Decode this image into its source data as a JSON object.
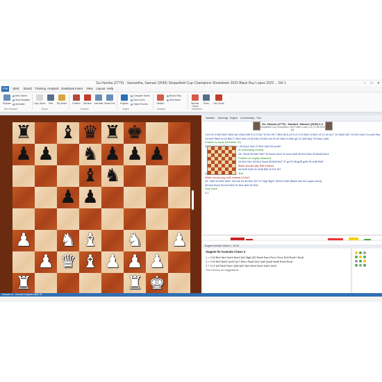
{
  "window": {
    "title": "Gu Harsha (2775) - Samantha, Samuel (2649) Sinquefield Cup Champions Showdown 2022  Black Ruy Lopez 2022 ... Rd 1"
  },
  "menu": [
    "File",
    "Start",
    "Board",
    "Training",
    "Analysis",
    "Database",
    "Insert",
    "View",
    "Layout",
    "Help"
  ],
  "ribbon": {
    "buttons": [
      {
        "label": "Replace",
        "color": "#6a8fb8"
      },
      {
        "label": "Copy Game",
        "color": "#d7d7d7"
      },
      {
        "label": "Print",
        "color": "#5b6f8a"
      },
      {
        "label": "Flip Board",
        "color": "#d9a441"
      },
      {
        "label": "Position",
        "color": "#b44a3a"
      },
      {
        "label": "Resume",
        "color": "#c23c2c"
      },
      {
        "label": "Annotate",
        "color": "#6a8fb8"
      },
      {
        "label": "Board Pos",
        "color": "#6a8fb8"
      },
      {
        "label": "Engines",
        "color": "#2f6fb4"
      },
      {
        "label": "Kibitzer",
        "color": "#d65a4a"
      },
      {
        "label": "Blunder Check",
        "color": "#d65a4a"
      },
      {
        "label": "Show",
        "color": "#5a6c88"
      },
      {
        "label": "Lets Check",
        "color": "#c23c2c"
      }
    ],
    "small_items": [
      "New Game",
      "Save Notation",
      "Annotate",
      "Compare Notes",
      "Save Lines",
      "Game Scores",
      "Board Help",
      "Add Notes"
    ],
    "groups": [
      "New Analysis",
      "Board",
      "Notation",
      "Engine",
      "Analysis",
      "Databases",
      "Tool",
      "Lets Check"
    ]
  },
  "notation": {
    "tabs": [
      "Notation",
      "Openings",
      "Engine",
      "Commentary",
      "Tree"
    ],
    "players": "Gu, Harsha (2775) - Samant, Samuel (2649) 0-0",
    "event": "Sinquefield Cup Champions 2022 Saint Louis (1.3)  21.08.2022",
    "result": "[A]",
    "lines": [
      {
        "text": "1.e4 e5 2.Nf3 Nc6 3.Bb5 a6 4.Ba4 Nf6 5.O-O Be7 6.Re1 b5 7.Bb3 d6 8.c3 O-O 9.h3 Na5 10.Bc2 c5 11.d4 Qc7 12.Nbd2 Bd7 13.Nf1 cxd4 14.cxd4 Rac8",
        "style": "n"
      },
      {
        "text": "15.Ne3 Rfe8 16.b3 Bf8 17.Bb2 Nc6 18.d5 Nb4 19.Bb1 a5 20.a3 Na6 21.Bd3 g6 22.Qd2 Bg7 23.Rac1 Qb8",
        "style": "n"
      },
      {
        "text": "Position is equal  (Stockfish 15)",
        "style": "c"
      },
      {
        "text": "24.Rxc8 Rxc8 25.Rc1 Rxc1+ 26.Qxc1 Nc5 27.Bc2 Qc8 28.Qxc8+",
        "style": "n"
      },
      {
        "text": "An interesting novelty.",
        "style": "c"
      },
      {
        "text": "28...Bxc8 29.Nd2 Nfd7 30.Ndc4 bxc4 31.bxc4 Nb6 32.Bc3 Na4 33.Bxa5 Nxc3",
        "style": "n"
      },
      {
        "text": "Position is roughly balanced",
        "style": "c"
      },
      {
        "text": "34.Ba4 Nb1 35.Bc2 Nxa3 36.Bd3 Bd7 37.g4 f5 38.gxf5 gxf5 39.exf5 Bxf5",
        "style": "n"
      },
      {
        "text": "Black should play Rd6 instead",
        "style": "r"
      },
      {
        "text": "40.Bxf5 Nxf5 41.Nxf5 Bf6 42.Kf1 Kf7",
        "style": "n"
      },
      {
        "text": "White must stay precise  42...Bc5",
        "style": "c"
      },
      {
        "text": "White should play Nd3 instead  43.Ke2",
        "style": "r"
      },
      {
        "text": "43...Nb5 44.Nd3 Nd4+ 45.Kd2 e4 46.Ne1 Ke7 47.Ng2 Bg5+ 48.Kc3 Kd6 (Black has the upper hand)",
        "style": "n"
      },
      {
        "text": "49.Ne3 Bxe3 50.fxe3 Nf3 51.Kb4 Ne5 52.Kb5",
        "style": "n"
      },
      {
        "text": "Only move",
        "style": "c"
      },
      {
        "text": "0-1",
        "style": "n"
      }
    ]
  },
  "engine": {
    "header": "Stagnie for Komodo Chess 3",
    "tab": "Engine Komodo Chess 3 - 32 bit",
    "lines": [
      "1 = 0.00  Bb3 Ne4 Nxe4 Bxe4 Qe2 Bg6 Qf2 Rac8 Rac1 Rxc1 Rxc1 Rc8 Rxc8+ Bxc8",
      "2 = 0.00  Bd3 Bxd3 Qxd3 Qc7 Rac1 Rac8 Qd2 Qa5 Qxa5 Nxa5 Rxc8 Rxc8",
      "3 + 0.12  a3 Rac8 Rac1 Qd8 Qe2 Ne4 Bxe4 Bxe4 Nxe4 dxe4",
      "One Dimony as suggestions"
    ]
  },
  "status": {
    "text": "Komodo 13 - Komodo Analysis Depth 32"
  },
  "colors": {
    "accent": "#2f6fb4",
    "move_text": "#1f3f9a",
    "comment": "#1a8a1a",
    "error": "#b01818",
    "board_light": "#f0d4b0",
    "board_dark": "#b5501f"
  },
  "board": {
    "description": "Position after move 14 (Black: Ra8 Bc8 Qd8 Rf8 Kg8 / pawns a7 b7 c7 f7 g7 / Nb6 ... )",
    "rows": [
      [
        "r",
        "",
        "b",
        "q",
        "r",
        "k",
        "",
        ""
      ],
      [
        "p",
        "p",
        "",
        "n",
        "p",
        "p",
        "p",
        ""
      ],
      [
        "",
        "",
        "",
        "b",
        "n",
        "",
        "",
        ""
      ],
      [
        "",
        "",
        "p",
        "p",
        "",
        "",
        "",
        ""
      ],
      [
        "",
        "",
        "",
        "",
        "",
        "",
        "",
        ""
      ],
      [
        "P",
        "",
        "N",
        "B",
        "",
        "N",
        "",
        "P"
      ],
      [
        "",
        "P",
        "Q",
        "B",
        "P",
        "P",
        "P",
        ""
      ],
      [
        "R",
        "",
        "",
        "",
        "",
        "R",
        "K",
        ""
      ]
    ]
  }
}
